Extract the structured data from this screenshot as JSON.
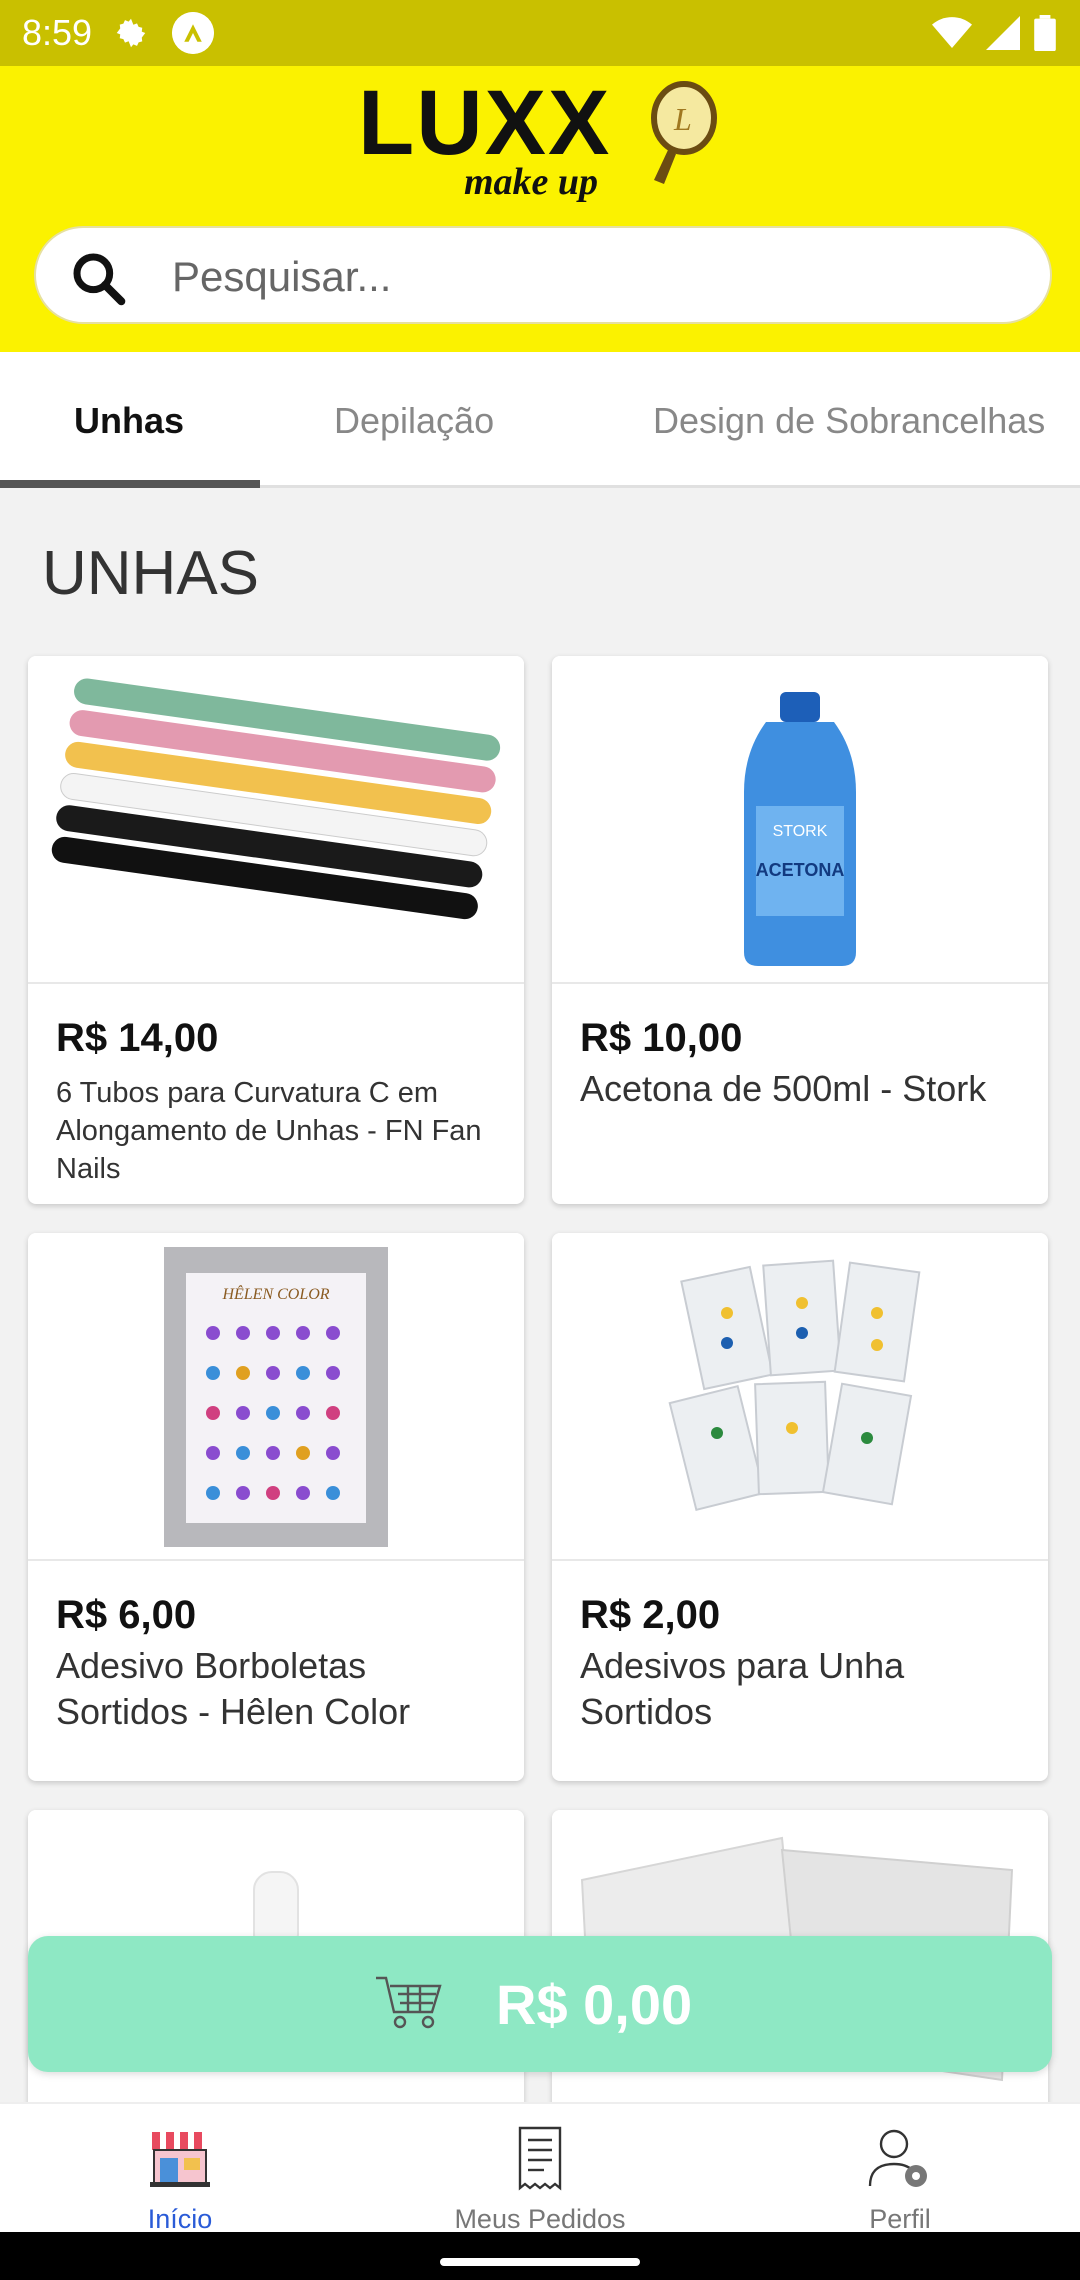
{
  "status_bar": {
    "time": "8:59"
  },
  "header": {
    "logo_text": "LUXX",
    "logo_subtext": "make up",
    "search": {
      "placeholder": "Pesquisar...",
      "value": ""
    }
  },
  "tabs": [
    {
      "label": "Unhas",
      "active": true
    },
    {
      "label": "Depilação",
      "active": false
    },
    {
      "label": "Design de Sobrancelhas",
      "active": false
    }
  ],
  "section_title": "UNHAS",
  "products": [
    {
      "price": "R$ 14,00",
      "name": "6 Tubos para Curvatura C em Alongamento de Unhas - FN Fan Nails"
    },
    {
      "price": "R$ 10,00",
      "name": "Acetona de 500ml - Stork"
    },
    {
      "price": "R$ 6,00",
      "name": "Adesivo Borboletas Sortidos - Hêlen Color"
    },
    {
      "price": "R$ 2,00",
      "name": "Adesivos para Unha Sortidos"
    }
  ],
  "cart": {
    "total": "R$ 0,00"
  },
  "bottom_nav": [
    {
      "label": "Início",
      "icon": "store-icon",
      "active": true
    },
    {
      "label": "Meus Pedidos",
      "icon": "receipt-icon",
      "active": false
    },
    {
      "label": "Perfil",
      "icon": "user-settings-icon",
      "active": false
    }
  ],
  "colors": {
    "header_yellow": "#fbf200",
    "status_bar": "#c9c000",
    "cart_green": "#8ee8c4",
    "active_nav": "#2a5bd7"
  }
}
